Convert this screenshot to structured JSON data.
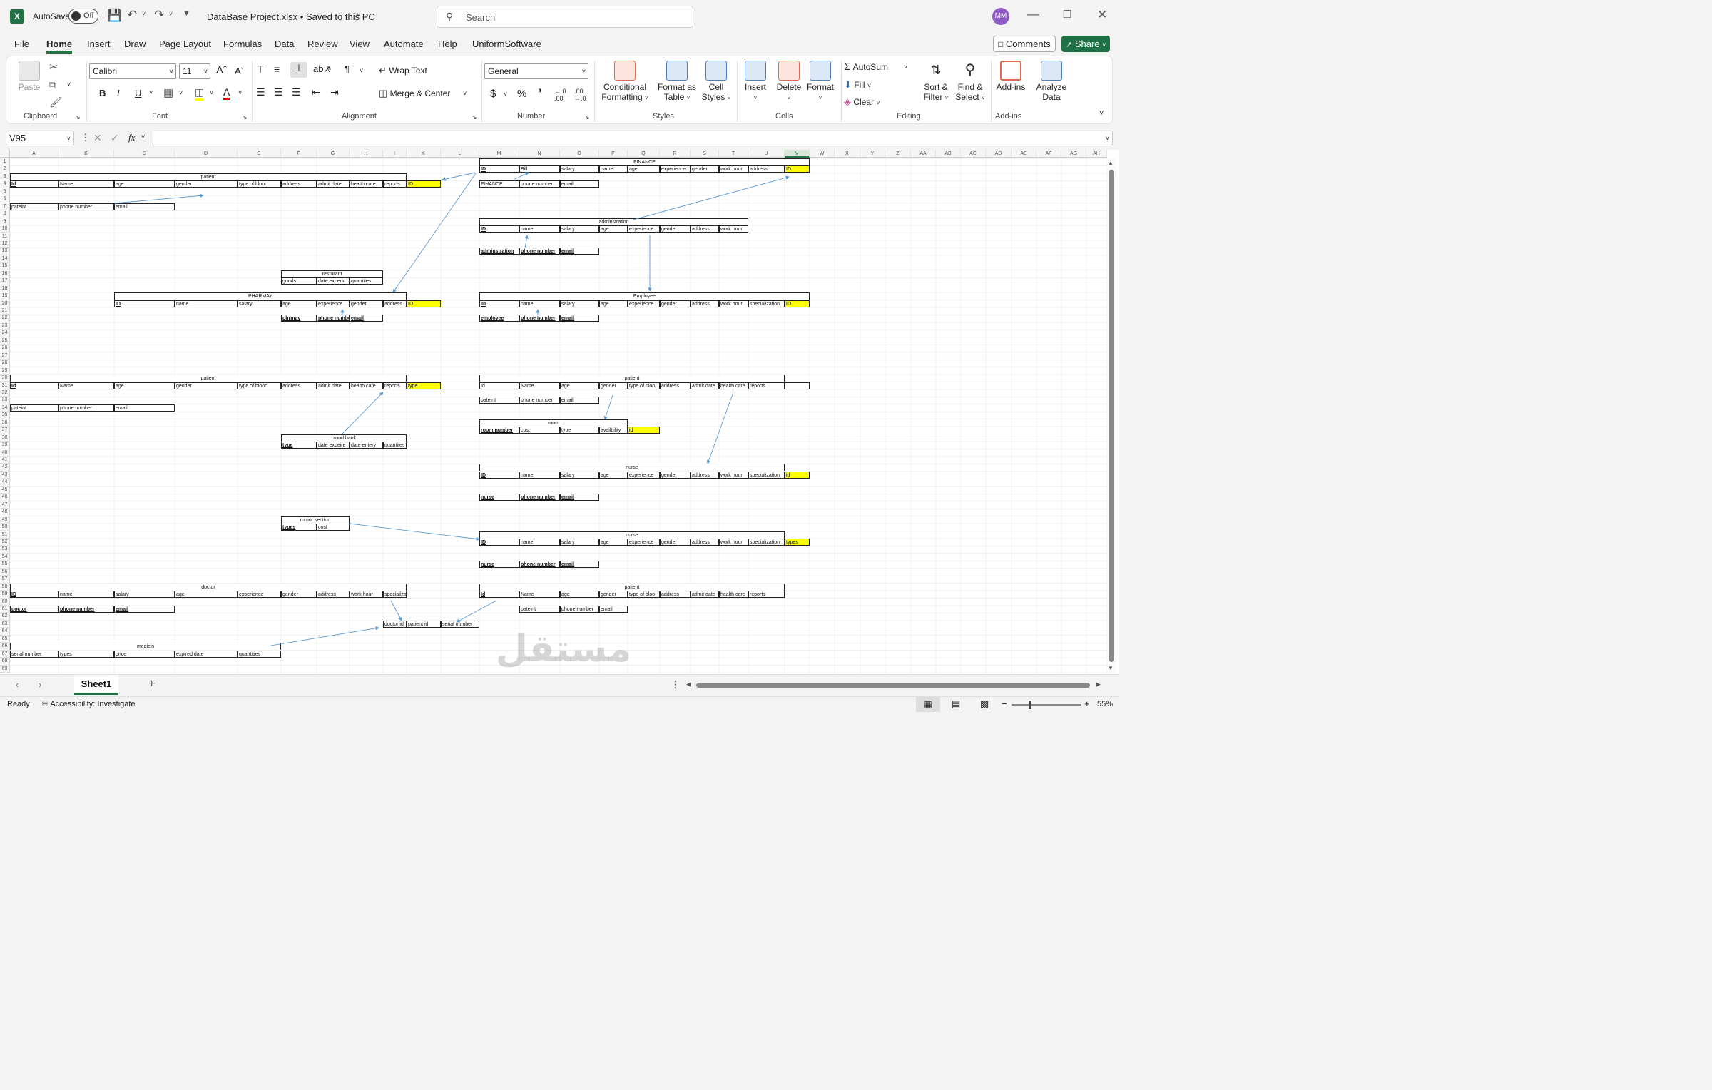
{
  "titlebar": {
    "autosave_label": "AutoSave",
    "autosave_state": "Off",
    "filename": "DataBase Project.xlsx • Saved to this PC",
    "search_placeholder": "Search",
    "user_initials": "MM"
  },
  "menu": [
    "File",
    "Home",
    "Insert",
    "Draw",
    "Page Layout",
    "Formulas",
    "Data",
    "Review",
    "View",
    "Automate",
    "Help",
    "UniformSoftware"
  ],
  "menu_active": "Home",
  "menu_right": {
    "comments": "Comments",
    "share": "Share"
  },
  "ribbon": {
    "clipboard": {
      "paste": "Paste",
      "label": "Clipboard"
    },
    "font": {
      "name": "Calibri",
      "size": "11",
      "label": "Font"
    },
    "alignment": {
      "wrap": "Wrap Text",
      "merge": "Merge & Center",
      "label": "Alignment"
    },
    "number": {
      "format": "General",
      "label": "Number"
    },
    "styles": {
      "cond1": "Conditional",
      "cond2": "Formatting",
      "fmt1": "Format as",
      "fmt2": "Table",
      "cell1": "Cell",
      "cell2": "Styles",
      "label": "Styles"
    },
    "cells": {
      "insert": "Insert",
      "delete": "Delete",
      "format": "Format",
      "label": "Cells"
    },
    "editing": {
      "autosum": "AutoSum",
      "fill": "Fill",
      "clear": "Clear",
      "sort1": "Sort &",
      "sort2": "Filter",
      "find1": "Find &",
      "find2": "Select",
      "label": "Editing"
    },
    "addins": {
      "addins": "Add-ins",
      "analyze1": "Analyze",
      "analyze2": "Data",
      "label": "Add-ins"
    }
  },
  "formula_bar": {
    "name_box": "V95",
    "fx": "fx",
    "value": ""
  },
  "columns": [
    "A",
    "B",
    "C",
    "D",
    "E",
    "F",
    "G",
    "H",
    "I",
    "K",
    "L",
    "M",
    "N",
    "O",
    "P",
    "Q",
    "R",
    "S",
    "T",
    "U",
    "V",
    "W",
    "X",
    "Y",
    "Z",
    "AA",
    "AB",
    "AC",
    "AD",
    "AE",
    "AF",
    "AG",
    "AH"
  ],
  "rows": [
    "1",
    "2",
    "3",
    "4",
    "5",
    "6",
    "7",
    "8",
    "9",
    "10",
    "11",
    "12",
    "13",
    "14",
    "15",
    "16",
    "17",
    "18",
    "19",
    "20",
    "21",
    "22",
    "23",
    "24",
    "25",
    "26",
    "27",
    "28",
    "29",
    "30",
    "31",
    "32",
    "33",
    "34",
    "35",
    "36",
    "37",
    "38",
    "39",
    "40",
    "41",
    "42",
    "43",
    "44",
    "45",
    "46",
    "47",
    "48",
    "49",
    "50",
    "51",
    "52",
    "53",
    "54",
    "55",
    "56",
    "57",
    "58",
    "59",
    "60",
    "61",
    "62",
    "63",
    "64",
    "65",
    "66",
    "67",
    "68",
    "69"
  ],
  "tables": {
    "t1_title": "patient",
    "t1": [
      "Id",
      "Name",
      "age",
      "gender",
      "type of blood",
      "address",
      "admit date",
      "health care",
      "reports",
      "ID"
    ],
    "t1b": [
      "pateint",
      "phone number",
      "email"
    ],
    "fin_title": "FINANCE",
    "fin": [
      "ID",
      "Bill",
      "salary",
      "name",
      "age",
      "experience",
      "gender",
      "work hour",
      "address",
      "ID"
    ],
    "fin_b": [
      "FINANCE",
      "phone number",
      "email"
    ],
    "adm_title": "adminstration",
    "adm": [
      "ID",
      "name",
      "salary",
      "age",
      "experience",
      "gender",
      "address",
      "work hour"
    ],
    "adm_b": [
      "adminstration",
      "phone number",
      "email"
    ],
    "rest_title": "resturant",
    "rest": [
      "goods",
      "date experid",
      "quantites"
    ],
    "ph_title": "PHARMAY",
    "ph": [
      "ID",
      "name",
      "salary",
      "age",
      "experience",
      "gender",
      "address",
      "ID"
    ],
    "ph_b": [
      "phrmay",
      "phone number",
      "email"
    ],
    "emp_title": "Employee",
    "emp": [
      "ID",
      "name",
      "salary",
      "age",
      "experience",
      "gender",
      "address",
      "work hour",
      "specialization",
      "ID"
    ],
    "emp_b": [
      "employee",
      "phone number",
      "email"
    ],
    "p2_title": "patient",
    "p2": [
      "Id",
      "Name",
      "age",
      "gender",
      "type of blood",
      "address",
      "admit date",
      "health care",
      "reports",
      "type"
    ],
    "p2b": [
      "pateint",
      "phone number",
      "email"
    ],
    "p3_title": "patient",
    "p3": [
      "Id",
      "Name",
      "age",
      "gender",
      "type of bloo",
      "address",
      "admit date",
      "health care",
      "reports"
    ],
    "p3b": [
      "pateint",
      "phone number",
      "email"
    ],
    "room_title": "room",
    "room": [
      "room number",
      "cost",
      "type",
      "availbility",
      "id"
    ],
    "bb_title": "blood bank",
    "bb": [
      "type",
      "date expeire",
      "date entery",
      "quantites"
    ],
    "nurse1_title": "nurse",
    "nurse1": [
      "ID",
      "name",
      "salary",
      "age",
      "experience",
      "gender",
      "address",
      "work hour",
      "specialization",
      "id"
    ],
    "nurse1_b": [
      "nurse",
      "phone number",
      "email"
    ],
    "rumor_title": "rumor section",
    "rumor": [
      "types",
      "cost"
    ],
    "nurse2_title": "nurse",
    "nurse2": [
      "ID",
      "name",
      "salary",
      "age",
      "experience",
      "gender",
      "address",
      "work hour",
      "specialization",
      "types"
    ],
    "nurse2_b": [
      "nurse",
      "phone number",
      "email"
    ],
    "doc_title": "doctor",
    "doc": [
      "ID",
      "name",
      "salary",
      "age",
      "experience",
      "gender",
      "address",
      "work hour",
      "specialization"
    ],
    "doc_b": [
      "doctor",
      "phone number",
      "email"
    ],
    "p4_title": "patient",
    "p4": [
      "Id",
      "Name",
      "age",
      "gender",
      "type of bloo",
      "address",
      "admit date",
      "health care",
      "reports"
    ],
    "p4b": [
      "pateint",
      "phone number",
      "email"
    ],
    "link": [
      "doctor id",
      "patient id",
      "serial number"
    ],
    "med_title": "medicin",
    "med": [
      "serial  number",
      "types",
      "price",
      "expired date",
      "quantities"
    ]
  },
  "sheet_tab": "Sheet1",
  "status": {
    "ready": "Ready",
    "accessibility": "Accessibility: Investigate",
    "zoom": "55%"
  },
  "watermark": {
    "arabic": "مستقل",
    "latin": "mostaql.com"
  },
  "colors": {
    "excel_green": "#217346",
    "highlight": "#ffff00",
    "arrow": "#5b9bd5",
    "share_green": "#1e7145"
  }
}
